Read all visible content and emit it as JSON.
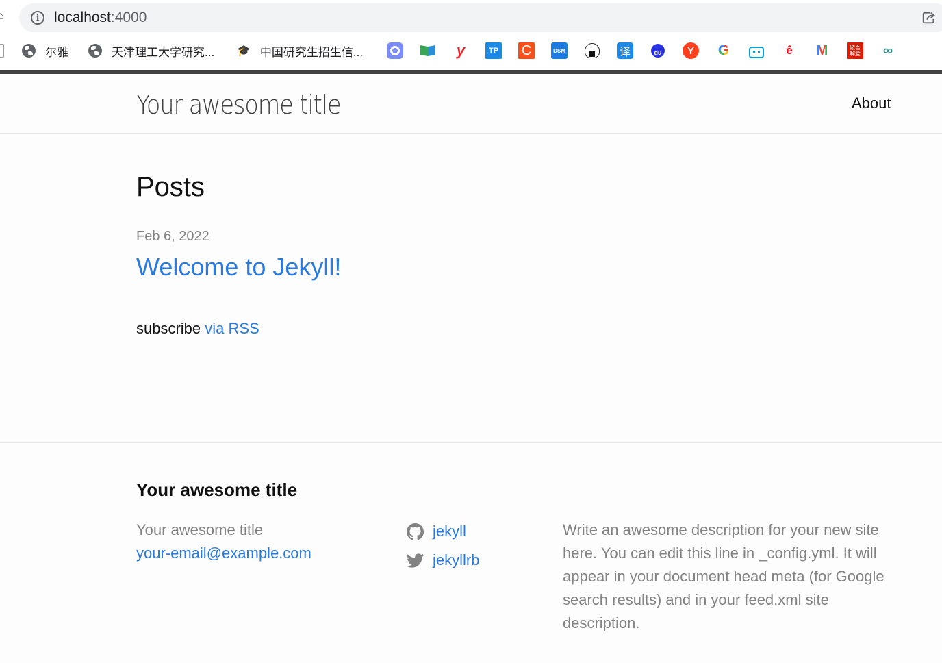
{
  "browser": {
    "url_host": "localhost",
    "url_port": ":4000",
    "bookmarks": [
      {
        "label": "尔雅",
        "icon": "globe-icon"
      },
      {
        "label": "天津理工大学研究...",
        "icon": "globe-icon"
      },
      {
        "label": "中国研究生招生信...",
        "icon": "graduation-cap-icon"
      }
    ],
    "favicons": [
      {
        "name": "circle-app-icon",
        "glyph": "◯",
        "color": "#7b8cf7"
      },
      {
        "name": "book-app-icon",
        "glyph": "",
        "color": "#3aa655"
      },
      {
        "name": "youdao-icon",
        "glyph": "y",
        "color": "#e4262c"
      },
      {
        "name": "tp-icon",
        "glyph": "TP",
        "color": "#1e88e5"
      },
      {
        "name": "c-app-icon",
        "glyph": "C",
        "color": "#f4511e"
      },
      {
        "name": "dsm-icon",
        "glyph": "DSM",
        "color": "#1e7be0"
      },
      {
        "name": "onigiri-icon",
        "glyph": "◕",
        "color": "#ffffff"
      },
      {
        "name": "translate-icon",
        "glyph": "译",
        "color": "#1e88e5"
      },
      {
        "name": "baidu-icon",
        "glyph": "du",
        "color": "#2932e1"
      },
      {
        "name": "yandex-icon",
        "glyph": "Y",
        "color": "#fc3f1d"
      },
      {
        "name": "google-icon",
        "glyph": "G",
        "color": "#ffffff"
      },
      {
        "name": "bilibili-icon",
        "glyph": "▭",
        "color": "#00a1d6"
      },
      {
        "name": "e-app-icon",
        "glyph": "e",
        "color": "#e60012"
      },
      {
        "name": "gmail-icon",
        "glyph": "M",
        "color": "#ffffff"
      },
      {
        "name": "52pojie-icon",
        "glyph": "破",
        "color": "#d81e06"
      },
      {
        "name": "infinity-app-icon",
        "glyph": "∞",
        "color": "#ffffff"
      }
    ]
  },
  "header": {
    "site_title": "Your awesome title",
    "nav": [
      {
        "label": "About"
      }
    ]
  },
  "main": {
    "heading": "Posts",
    "posts": [
      {
        "date": "Feb 6, 2022",
        "title": "Welcome to Jekyll!"
      }
    ],
    "rss_prefix": "subscribe",
    "rss_link": "via RSS"
  },
  "footer": {
    "heading": "Your awesome title",
    "name": "Your awesome title",
    "email": "your-email@example.com",
    "social": [
      {
        "icon": "github-icon",
        "label": "jekyll"
      },
      {
        "icon": "twitter-icon",
        "label": "jekyllrb"
      }
    ],
    "description": "Write an awesome description for your new site here. You can edit this line in _config.yml. It will appear in your document head meta (for Google search results) and in your feed.xml site description."
  },
  "colors": {
    "link": "#2a7ae2",
    "text": "#111111",
    "muted": "#828282",
    "top_bar": "#424242",
    "border": "#e8e8e8"
  }
}
